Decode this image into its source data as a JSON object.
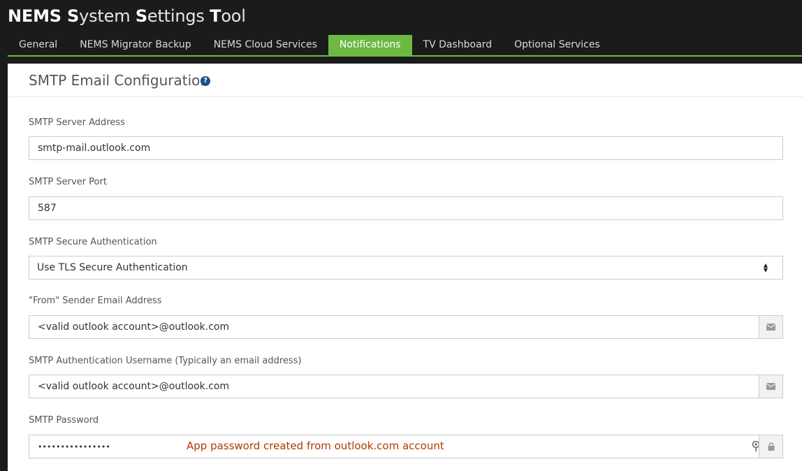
{
  "app": {
    "title_parts": [
      {
        "text": "N",
        "bold": true
      },
      {
        "text": "EMS ",
        "bold": true
      },
      {
        "text": "S",
        "bold": true
      },
      {
        "text": "ystem ",
        "bold": false
      },
      {
        "text": "S",
        "bold": true
      },
      {
        "text": "ettings ",
        "bold": false
      },
      {
        "text": "T",
        "bold": true
      },
      {
        "text": "ool",
        "bold": false
      }
    ]
  },
  "tabs": [
    {
      "label": "General",
      "active": false
    },
    {
      "label": "NEMS Migrator Backup",
      "active": false
    },
    {
      "label": "NEMS Cloud Services",
      "active": false
    },
    {
      "label": "Notifications",
      "active": true
    },
    {
      "label": "TV Dashboard",
      "active": false
    },
    {
      "label": "Optional Services",
      "active": false
    }
  ],
  "section": {
    "title": "SMTP Email Configuration",
    "help_icon": "question-circle-icon"
  },
  "form": {
    "server_address": {
      "label": "SMTP Server Address",
      "value": "smtp-mail.outlook.com"
    },
    "server_port": {
      "label": "SMTP Server Port",
      "value": "587"
    },
    "secure_auth": {
      "label": "SMTP Secure Authentication",
      "selected": "Use TLS Secure Authentication"
    },
    "from_address": {
      "label": "\"From\" Sender Email Address",
      "value": "<valid outlook account>@outlook.com",
      "icon": "envelope-icon"
    },
    "auth_username": {
      "label": "SMTP Authentication Username (Typically an email address)",
      "value": "<valid outlook account>@outlook.com",
      "icon": "envelope-icon"
    },
    "password": {
      "label": "SMTP Password",
      "value": "••••••••••••••••",
      "annotation": "App password created from outlook.com account",
      "icon": "lock-icon",
      "extra_icon": "key-icon"
    }
  },
  "colors": {
    "accent": "#6cba44",
    "header_bg": "#1b1b1b",
    "annotation": "#b03a00"
  }
}
